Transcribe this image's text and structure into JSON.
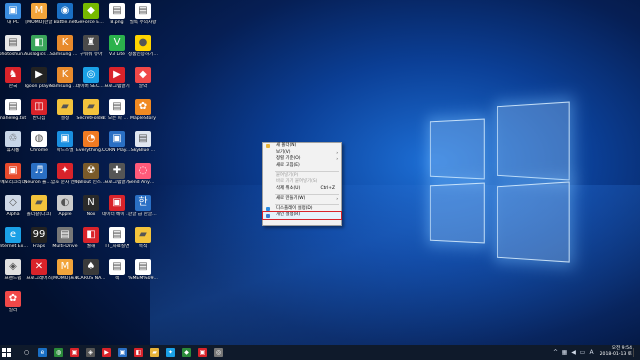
{
  "desktop": {
    "icons": [
      {
        "label": "내 PC",
        "icon": "computer-icon",
        "color": "#3b8de0",
        "glyph": "▣"
      },
      {
        "label": "[MOMO]한글",
        "icon": "app-icon",
        "color": "#f2a43a",
        "glyph": "M"
      },
      {
        "label": "Battle.net",
        "icon": "battlenet-icon",
        "color": "#1a6fc4",
        "glyph": "◉"
      },
      {
        "label": "GeForce Experience",
        "icon": "geforce-icon",
        "color": "#76b900",
        "glyph": "◆"
      },
      {
        "label": "8.png",
        "icon": "image-file-icon",
        "color": "#ffffff",
        "glyph": "▤"
      },
      {
        "label": "필독 주의사항",
        "icon": "text-file-icon",
        "color": "#ffffff",
        "glyph": "▤"
      },
      {
        "label": "photoshun...",
        "icon": "file-icon",
        "color": "#e8e8e8",
        "glyph": "▤"
      },
      {
        "label": "Auslogics Disk Defrag",
        "icon": "defrag-icon",
        "color": "#3aa55a",
        "glyph": "◧"
      },
      {
        "label": "Samsung Kies",
        "icon": "kies-icon",
        "color": "#e88a2c",
        "glyph": "K"
      },
      {
        "label": "구워줘 유아",
        "icon": "game-icon",
        "color": "#4a4a4a",
        "glyph": "♜"
      },
      {
        "label": "V3 Lite",
        "icon": "v3-icon",
        "color": "#2bb24c",
        "glyph": "V"
      },
      {
        "label": "정품인증하기 Kit 이용",
        "icon": "kakao-icon",
        "color": "#ffd400",
        "glyph": "●"
      },
      {
        "label": "한국",
        "icon": "app-icon",
        "color": "#d9232a",
        "glyph": "♞"
      },
      {
        "label": "Igoon player",
        "icon": "player-icon",
        "color": "#222222",
        "glyph": "▶"
      },
      {
        "label": "Samsung Kies (Lite)",
        "icon": "kies-icon",
        "color": "#e88a2c",
        "glyph": "K"
      },
      {
        "label": "네이버 SECUR...",
        "icon": "secure-icon",
        "color": "#1aa0e6",
        "glyph": "◎"
      },
      {
        "label": "프로그램깔기",
        "icon": "app-icon",
        "color": "#d9232a",
        "glyph": "▶"
      },
      {
        "label": "알약",
        "icon": "alyac-icon",
        "color": "#f04848",
        "glyph": "◆"
      },
      {
        "label": "naheleg.txt",
        "icon": "text-file-icon",
        "color": "#ffffff",
        "glyph": "▤"
      },
      {
        "label": "반디집",
        "icon": "bandizip-icon",
        "color": "#d9232a",
        "glyph": "◫"
      },
      {
        "label": "설정",
        "icon": "folder-icon",
        "color": "#f3c33c",
        "glyph": "▰"
      },
      {
        "label": "SecretFolder",
        "icon": "folder-icon",
        "color": "#f3c33c",
        "glyph": "▰"
      },
      {
        "label": "1. 모든 파 일을 한번...",
        "icon": "text-file-icon",
        "color": "#ffffff",
        "glyph": "▤"
      },
      {
        "label": "MapleStory",
        "icon": "maple-icon",
        "color": "#f08a22",
        "glyph": "✿"
      },
      {
        "label": "휴지통",
        "icon": "recycle-bin-icon",
        "color": "#c8d6e8",
        "glyph": "♲"
      },
      {
        "label": "Chrome",
        "icon": "chrome-icon",
        "color": "#ffffff",
        "glyph": "◍"
      },
      {
        "label": "학드스엘",
        "icon": "app-icon",
        "color": "#1a8fe0",
        "glyph": "▣"
      },
      {
        "label": "Everything Search",
        "icon": "search-app-icon",
        "color": "#f07a22",
        "glyph": "◔"
      },
      {
        "label": "CORN Play... (x86)",
        "icon": "player-icon",
        "color": "#2a6fc4",
        "glyph": "▣"
      },
      {
        "label": "SkyBlue ...",
        "icon": "app-icon",
        "color": "#e0e6f0",
        "glyph": "▤"
      },
      {
        "label": "메모리크리너",
        "icon": "app-icon",
        "color": "#e84a2c",
        "glyph": "▣"
      },
      {
        "label": "Neuron 플레이어",
        "icon": "player-icon",
        "color": "#2a6fc4",
        "glyph": "♬"
      },
      {
        "label": "암호 문자 엔터",
        "icon": "app-icon",
        "color": "#d9232a",
        "glyph": "✦"
      },
      {
        "label": "Fallout 인스톨 Kwasi",
        "icon": "game-icon",
        "color": "#7a5a2a",
        "glyph": "☢"
      },
      {
        "label": "프로그램깔기",
        "icon": "app-icon",
        "color": "#555555",
        "glyph": "✚"
      },
      {
        "label": "Send Anywhe...",
        "icon": "send-icon",
        "color": "#ff5a7a",
        "glyph": "◌"
      },
      {
        "label": "Alpha",
        "icon": "app-icon",
        "color": "#cfd8e6",
        "glyph": "◇"
      },
      {
        "label": "폴더갈(다크)",
        "icon": "folder-icon",
        "color": "#f3c33c",
        "glyph": "▰"
      },
      {
        "label": "Apple",
        "icon": "app-icon",
        "color": "#cccccc",
        "glyph": "◐"
      },
      {
        "label": "Nox",
        "icon": "nox-icon",
        "color": "#2a2a2a",
        "glyph": "N"
      },
      {
        "label": "데이터 베이 스 지원 알",
        "icon": "app-icon",
        "color": "#d9232a",
        "glyph": "▣"
      },
      {
        "label": "한글 급 한글 2007",
        "icon": "hwp-icon",
        "color": "#2a6fc4",
        "glyph": "한"
      },
      {
        "label": "Internet Explorer",
        "icon": "ie-icon",
        "color": "#1aa0e6",
        "glyph": "e"
      },
      {
        "label": "Fraps",
        "icon": "fraps-icon",
        "color": "#222222",
        "glyph": "99"
      },
      {
        "label": "Multi-Drive",
        "icon": "drive-icon",
        "color": "#777777",
        "glyph": "▤"
      },
      {
        "label": "월해",
        "icon": "app-icon",
        "color": "#d9232a",
        "glyph": "◧"
      },
      {
        "label": "TT_자료실면",
        "icon": "file-icon",
        "color": "#ffffff",
        "glyph": "▤"
      },
      {
        "label": "목적",
        "icon": "folder-icon",
        "color": "#f3c33c",
        "glyph": "▰"
      },
      {
        "label": "프렌드쉽",
        "icon": "app-icon",
        "color": "#e0e0e0",
        "glyph": "◈"
      },
      {
        "label": "프로그래머스",
        "icon": "app-icon",
        "color": "#d9232a",
        "glyph": "✕"
      },
      {
        "label": "[MOMO]프로",
        "icon": "app-icon",
        "color": "#f2a43a",
        "glyph": "M"
      },
      {
        "label": "ICARUS NAVER",
        "icon": "game-icon",
        "color": "#3a3a3a",
        "glyph": "♠"
      },
      {
        "label": "책",
        "icon": "file-icon",
        "color": "#ffffff",
        "glyph": "▤"
      },
      {
        "label": "%MEM%09...",
        "icon": "file-icon",
        "color": "#ffffff",
        "glyph": "▤"
      },
      {
        "label": "일러",
        "icon": "app-icon",
        "color": "#f04848",
        "glyph": "✿"
      }
    ]
  },
  "context_menu": {
    "items": [
      {
        "type": "item",
        "label": "새 폴더(N)",
        "icon": "new-folder-icon",
        "icon_color": "#e8b43a",
        "disabled": false
      },
      {
        "type": "item",
        "label": "보기(V)",
        "arrow": "›",
        "disabled": false
      },
      {
        "type": "item",
        "label": "정렬 기준(O)",
        "arrow": "›",
        "disabled": false
      },
      {
        "type": "item",
        "label": "새로 고침(E)",
        "disabled": false
      },
      {
        "type": "sep"
      },
      {
        "type": "item",
        "label": "붙여넣기(P)",
        "disabled": true
      },
      {
        "type": "item",
        "label": "바로 가기 붙여넣기(S)",
        "disabled": true
      },
      {
        "type": "item",
        "label": "삭제 취소(U)",
        "shortcut": "Ctrl+Z",
        "disabled": false
      },
      {
        "type": "sep"
      },
      {
        "type": "item",
        "label": "새로 만들기(W)",
        "arrow": "›",
        "disabled": false
      },
      {
        "type": "sep"
      },
      {
        "type": "item",
        "label": "디스플레이 설정(D)",
        "icon": "display-icon",
        "icon_color": "#2a8be0",
        "disabled": false
      },
      {
        "type": "item",
        "label": "개인 설정(R)",
        "icon": "personalize-icon",
        "icon_color": "#3a7ad0",
        "disabled": false,
        "highlighted": true
      }
    ]
  },
  "taskbar": {
    "apps": [
      {
        "icon": "search-icon",
        "glyph": "○",
        "color": "#0f1a2b"
      },
      {
        "icon": "edge-icon",
        "glyph": "e",
        "color": "#1a6fc4"
      },
      {
        "icon": "chrome-icon",
        "glyph": "◍",
        "color": "#2a8a3a"
      },
      {
        "icon": "app-icon",
        "glyph": "▣",
        "color": "#d9232a"
      },
      {
        "icon": "app-icon",
        "glyph": "◈",
        "color": "#555555"
      },
      {
        "icon": "youtube-icon",
        "glyph": "▶",
        "color": "#d9232a"
      },
      {
        "icon": "app-icon",
        "glyph": "▣",
        "color": "#2a6fc4"
      },
      {
        "icon": "app-icon",
        "glyph": "◧",
        "color": "#d9232a"
      },
      {
        "icon": "explorer-icon",
        "glyph": "▰",
        "color": "#e8b43a"
      },
      {
        "icon": "twitter-icon",
        "glyph": "✦",
        "color": "#1aa0e6"
      },
      {
        "icon": "app-icon",
        "glyph": "◆",
        "color": "#2a8a3a"
      },
      {
        "icon": "app-icon",
        "glyph": "▣",
        "color": "#d9232a"
      },
      {
        "icon": "app-icon",
        "glyph": "◎",
        "color": "#777777"
      }
    ],
    "tray_icons": [
      "chevron-up-icon",
      "network-icon",
      "volume-icon",
      "keyboard-icon",
      "ime-icon"
    ],
    "tray_glyphs": [
      "^",
      "▦",
      "◀",
      "▭",
      "A"
    ],
    "time": "오전 9:54",
    "date": "2018-01-13 토"
  }
}
